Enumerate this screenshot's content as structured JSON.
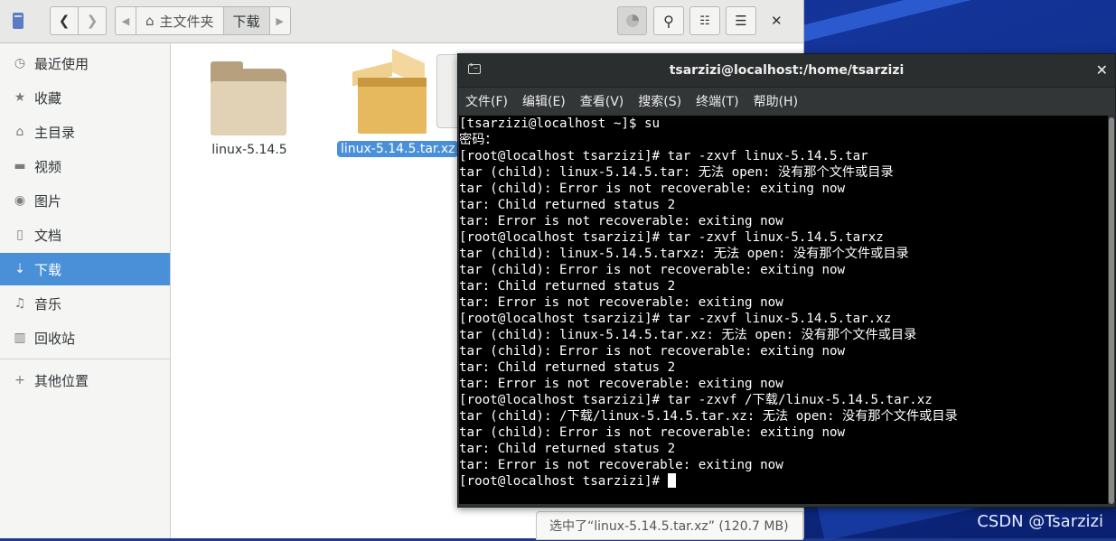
{
  "file_manager": {
    "path": [
      "主文件夹",
      "下载"
    ],
    "sidebar": [
      {
        "label": "最近使用",
        "icon": "clock-icon"
      },
      {
        "label": "收藏",
        "icon": "star-icon"
      },
      {
        "label": "主目录",
        "icon": "home-icon"
      },
      {
        "label": "视频",
        "icon": "video-icon"
      },
      {
        "label": "图片",
        "icon": "camera-icon"
      },
      {
        "label": "文档",
        "icon": "document-icon"
      },
      {
        "label": "下载",
        "icon": "download-icon",
        "selected": true
      },
      {
        "label": "音乐",
        "icon": "music-icon"
      },
      {
        "label": "回收站",
        "icon": "trash-icon"
      },
      {
        "label": "其他位置",
        "icon": "plus-icon"
      }
    ],
    "files": [
      {
        "name": "linux-5.14.5",
        "type": "folder"
      },
      {
        "name": "linux-5.14.5.tar.xz",
        "type": "archive",
        "selected": true
      }
    ],
    "status": "选中了“linux-5.14.5.tar.xz” (120.7 MB)"
  },
  "terminal": {
    "title": "tsarzizi@localhost:/home/tsarzizi",
    "menu": [
      "文件(F)",
      "编辑(E)",
      "查看(V)",
      "搜索(S)",
      "终端(T)",
      "帮助(H)"
    ],
    "lines": [
      "[tsarzizi@localhost ~]$ su",
      "密码：",
      "[root@localhost tsarzizi]# tar -zxvf linux-5.14.5.tar",
      "tar (child): linux-5.14.5.tar: 无法 open: 没有那个文件或目录",
      "tar (child): Error is not recoverable: exiting now",
      "tar: Child returned status 2",
      "tar: Error is not recoverable: exiting now",
      "[root@localhost tsarzizi]# tar -zxvf linux-5.14.5.tarxz",
      "tar (child): linux-5.14.5.tarxz: 无法 open: 没有那个文件或目录",
      "tar (child): Error is not recoverable: exiting now",
      "tar: Child returned status 2",
      "tar: Error is not recoverable: exiting now",
      "[root@localhost tsarzizi]# tar -zxvf linux-5.14.5.tar.xz",
      "tar (child): linux-5.14.5.tar.xz: 无法 open: 没有那个文件或目录",
      "tar (child): Error is not recoverable: exiting now",
      "tar: Child returned status 2",
      "tar: Error is not recoverable: exiting now",
      "[root@localhost tsarzizi]# tar -zxvf /下载/linux-5.14.5.tar.xz",
      "tar (child): /下载/linux-5.14.5.tar.xz: 无法 open: 没有那个文件或目录",
      "tar (child): Error is not recoverable: exiting now",
      "tar: Child returned status 2",
      "tar: Error is not recoverable: exiting now"
    ],
    "prompt": "[root@localhost tsarzizi]# "
  },
  "watermark": "CSDN @Tsarzizi"
}
